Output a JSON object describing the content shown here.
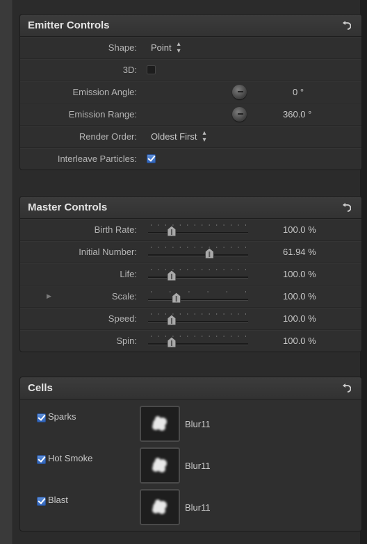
{
  "emitter": {
    "title": "Emitter Controls",
    "shape_label": "Shape:",
    "shape_value": "Point",
    "threed_label": "3D:",
    "threed_checked": false,
    "angle_label": "Emission Angle:",
    "angle_value": "0 °",
    "range_label": "Emission Range:",
    "range_value": "360.0 °",
    "order_label": "Render Order:",
    "order_value": "Oldest First",
    "interleave_label": "Interleave Particles:",
    "interleave_checked": true
  },
  "master": {
    "title": "Master Controls",
    "rows": [
      {
        "label": "Birth Rate:",
        "value": "100.0 %",
        "level": 0.22
      },
      {
        "label": "Initial Number:",
        "value": "61.94 %",
        "level": 0.62
      },
      {
        "label": "Life:",
        "value": "100.0 %",
        "level": 0.22
      },
      {
        "label": "Scale:",
        "value": "100.0 %",
        "level": 0.27
      },
      {
        "label": "Speed:",
        "value": "100.0 %",
        "level": 0.22
      },
      {
        "label": "Spin:",
        "value": "100.0 %",
        "level": 0.22
      }
    ]
  },
  "cells": {
    "title": "Cells",
    "items": [
      {
        "name": "Sparks",
        "file": "Blur11",
        "checked": true
      },
      {
        "name": "Hot Smoke",
        "file": "Blur11",
        "checked": true
      },
      {
        "name": "Blast",
        "file": "Blur11",
        "checked": true
      }
    ]
  },
  "colors": {
    "accent": "#3f72c9",
    "panel_bg": "#2f2f2f",
    "header_bg": "#383838"
  },
  "icons": {
    "reset": "reset-arrow-icon",
    "popup": "up-down-arrows-icon",
    "disclosure": "disclosure-triangle-icon"
  }
}
